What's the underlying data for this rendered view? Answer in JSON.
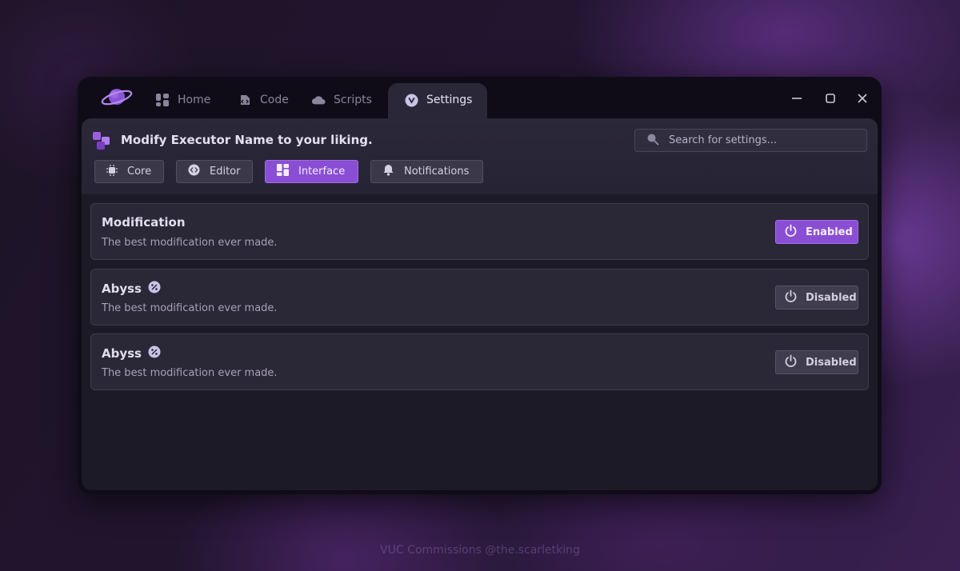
{
  "tabs": [
    {
      "label": "Home",
      "icon": "grid-icon"
    },
    {
      "label": "Code",
      "icon": "code-icon"
    },
    {
      "label": "Scripts",
      "icon": "cloud-icon"
    },
    {
      "label": "Settings",
      "icon": "settings-icon",
      "active": true
    }
  ],
  "header": {
    "title": "Modify Executor Name to your liking.",
    "search_placeholder": "Search for settings..."
  },
  "categories": [
    {
      "label": "Core",
      "icon": "chip-icon"
    },
    {
      "label": "Editor",
      "icon": "code-circle-icon"
    },
    {
      "label": "Interface",
      "icon": "layout-icon",
      "active": true
    },
    {
      "label": "Notifications",
      "icon": "bell-icon"
    }
  ],
  "settings": [
    {
      "title": "Modification",
      "description": "The best modification ever made.",
      "status": "Enabled",
      "badge": false
    },
    {
      "title": "Abyss",
      "description": "The best modification ever made.",
      "status": "Disabled",
      "badge": true
    },
    {
      "title": "Abyss",
      "description": "The best modification ever made.",
      "status": "Disabled",
      "badge": true
    }
  ],
  "watermark": "VUC Commissions @the.scarletking",
  "colors": {
    "accent": "#8a4ed4",
    "panel": "#1c1a27",
    "window": "#0f0c18"
  }
}
